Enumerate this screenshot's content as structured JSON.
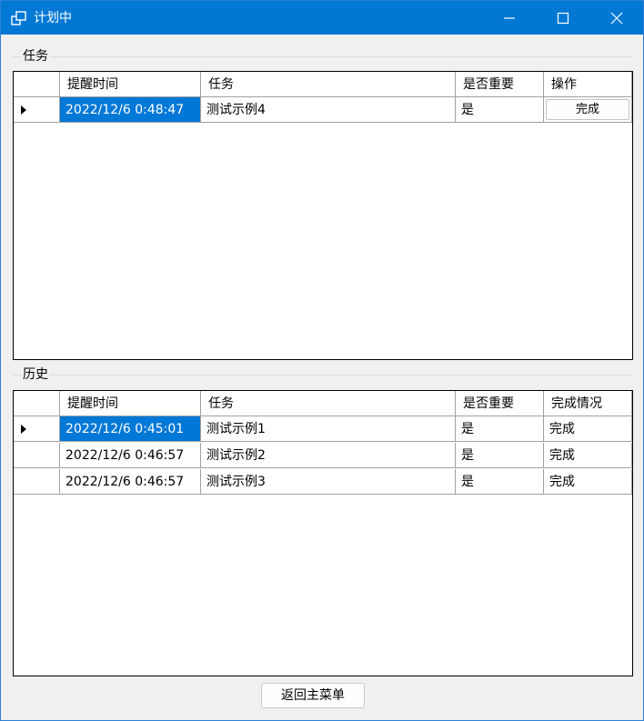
{
  "window": {
    "title": "计划中"
  },
  "tasks": {
    "group_label": "任务",
    "columns": [
      "提醒时间",
      "任务",
      "是否重要",
      "操作"
    ],
    "rows": [
      {
        "time": "2022/12/6 0:48:47",
        "task": "测试示例4",
        "important": "是",
        "action": "完成"
      }
    ]
  },
  "history": {
    "group_label": "历史",
    "columns": [
      "提醒时间",
      "任务",
      "是否重要",
      "完成情况"
    ],
    "rows": [
      {
        "time": "2022/12/6 0:45:01",
        "task": "测试示例1",
        "important": "是",
        "status": "完成"
      },
      {
        "time": "2022/12/6 0:46:57",
        "task": "测试示例2",
        "important": "是",
        "status": "完成"
      },
      {
        "time": "2022/12/6 0:46:57",
        "task": "测试示例3",
        "important": "是",
        "status": "完成"
      }
    ]
  },
  "footer": {
    "back_button_label": "返回主菜单"
  },
  "colors": {
    "titlebar": "#0078d4",
    "selection": "#0078d7",
    "window_bg": "#f0f0f0"
  },
  "icons": [
    "app-icon",
    "minimize-icon",
    "maximize-icon",
    "close-icon",
    "row-pointer-icon"
  ]
}
